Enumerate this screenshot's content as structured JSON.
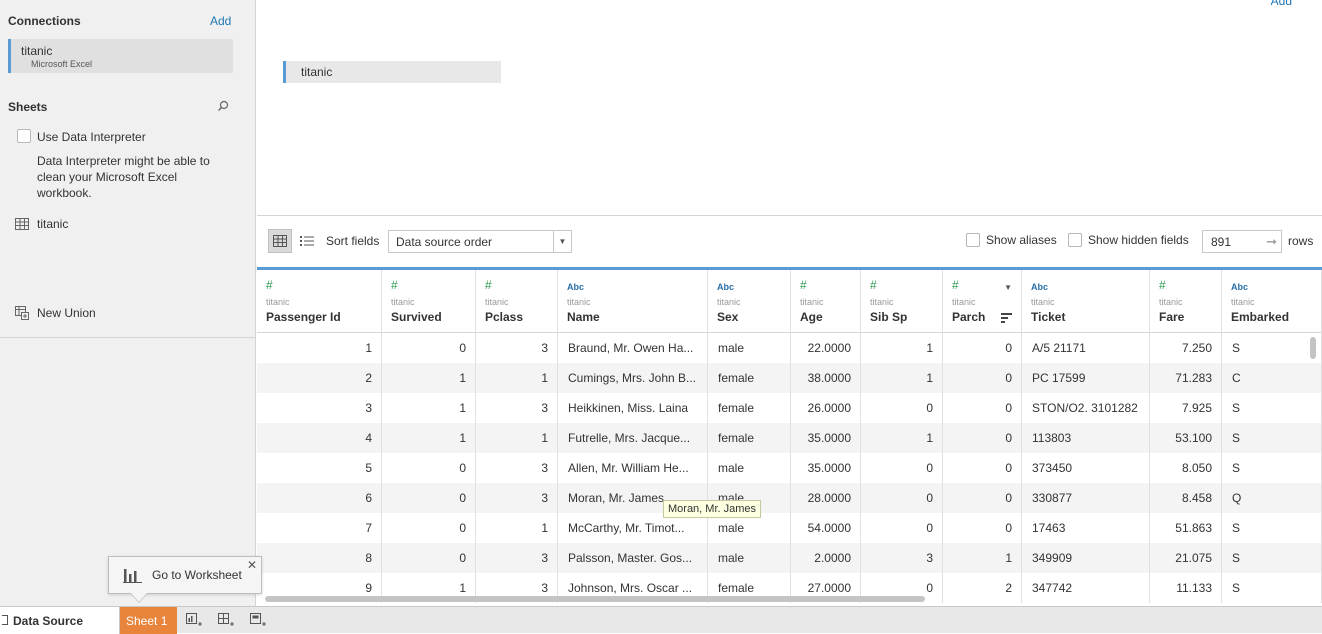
{
  "connections": {
    "title": "Connections",
    "add_label": "Add",
    "items": [
      {
        "name": "titanic",
        "type": "Microsoft Excel"
      }
    ]
  },
  "sheets": {
    "title": "Sheets",
    "search_icon": "search-icon",
    "interpreter_label": "Use Data Interpreter",
    "interpreter_note": "Data Interpreter might be able to clean your Microsoft Excel workbook.",
    "items": [
      {
        "name": "titanic",
        "icon": "table-icon"
      }
    ],
    "new_union": "New Union"
  },
  "canvas": {
    "table_name": "titanic",
    "top_right_fragment": "Add"
  },
  "toolbar": {
    "sort_label": "Sort fields",
    "sort_value": "Data source order",
    "show_aliases": "Show aliases",
    "show_hidden": "Show hidden fields",
    "rows_value": "891",
    "rows_label": "rows"
  },
  "columns": [
    {
      "type": "#",
      "type_kind": "number",
      "source": "titanic",
      "name": "Passenger Id"
    },
    {
      "type": "#",
      "type_kind": "number",
      "source": "titanic",
      "name": "Survived"
    },
    {
      "type": "#",
      "type_kind": "number",
      "source": "titanic",
      "name": "Pclass"
    },
    {
      "type": "Abc",
      "type_kind": "string",
      "source": "titanic",
      "name": "Name"
    },
    {
      "type": "Abc",
      "type_kind": "string",
      "source": "titanic",
      "name": "Sex"
    },
    {
      "type": "#",
      "type_kind": "number",
      "source": "titanic",
      "name": "Age"
    },
    {
      "type": "#",
      "type_kind": "number",
      "source": "titanic",
      "name": "Sib Sp"
    },
    {
      "type": "#",
      "type_kind": "number",
      "source": "titanic",
      "name": "Parch"
    },
    {
      "type": "Abc",
      "type_kind": "string",
      "source": "titanic",
      "name": "Ticket"
    },
    {
      "type": "#",
      "type_kind": "number",
      "source": "titanic",
      "name": "Fare"
    },
    {
      "type": "Abc",
      "type_kind": "string",
      "source": "titanic",
      "name": "Embarked"
    }
  ],
  "rows": [
    [
      "1",
      "0",
      "3",
      "Braund, Mr. Owen Ha...",
      "male",
      "22.0000",
      "1",
      "0",
      "A/5 21171",
      "7.250",
      "S"
    ],
    [
      "2",
      "1",
      "1",
      "Cumings, Mrs. John B...",
      "female",
      "38.0000",
      "1",
      "0",
      "PC 17599",
      "71.283",
      "C"
    ],
    [
      "3",
      "1",
      "3",
      "Heikkinen, Miss. Laina",
      "female",
      "26.0000",
      "0",
      "0",
      "STON/O2. 3101282",
      "7.925",
      "S"
    ],
    [
      "4",
      "1",
      "1",
      "Futrelle, Mrs. Jacque...",
      "female",
      "35.0000",
      "1",
      "0",
      "113803",
      "53.100",
      "S"
    ],
    [
      "5",
      "0",
      "3",
      "Allen, Mr. William He...",
      "male",
      "35.0000",
      "0",
      "0",
      "373450",
      "8.050",
      "S"
    ],
    [
      "6",
      "0",
      "3",
      "Moran, Mr. James",
      "male",
      "28.0000",
      "0",
      "0",
      "330877",
      "8.458",
      "Q"
    ],
    [
      "7",
      "0",
      "1",
      "McCarthy, Mr. Timot...",
      "male",
      "54.0000",
      "0",
      "0",
      "17463",
      "51.863",
      "S"
    ],
    [
      "8",
      "0",
      "3",
      "Palsson, Master. Gos...",
      "male",
      "2.0000",
      "3",
      "1",
      "349909",
      "21.075",
      "S"
    ],
    [
      "9",
      "1",
      "3",
      "Johnson, Mrs. Oscar ...",
      "female",
      "27.0000",
      "0",
      "2",
      "347742",
      "11.133",
      "S"
    ]
  ],
  "tooltip": "Moran, Mr. James",
  "bottom": {
    "data_source_tab": "Data Source",
    "sheet_tab": "Sheet 1",
    "go_to_worksheet": "Go to Worksheet"
  },
  "colors": {
    "accent": "#5b9bd5",
    "link": "#1f77b4",
    "sheet_tab": "#e8843c",
    "number_type": "#2e9a52",
    "string_type": "#2a6ea8"
  }
}
